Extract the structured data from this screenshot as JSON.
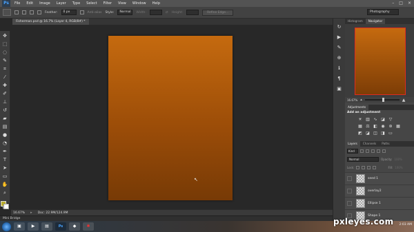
{
  "app": {
    "logo": "Ps"
  },
  "menu": [
    "File",
    "Edit",
    "Image",
    "Layer",
    "Type",
    "Select",
    "Filter",
    "View",
    "Window",
    "Help"
  ],
  "window_controls": {
    "minimize": "–",
    "maximize": "□",
    "close": "×"
  },
  "options_bar": {
    "feather_label": "Feather:",
    "feather_value": "0 px",
    "anti_alias_label": "Anti-alias",
    "style_label": "Style:",
    "style_value": "Normal",
    "width_label": "Width:",
    "height_label": "Height:",
    "refine_edge_label": "Refine Edge...",
    "workspace": "Photography"
  },
  "document_tab": "Fisherman.psd @ 16.7% (Layer 4, RGB/8#) *",
  "status_bar": {
    "zoom": "16.67%",
    "doc_size": "Doc: 22.9M/124.9M"
  },
  "mini_bridge": "Mini Bridge",
  "panels": {
    "nav_tabs": [
      "Histogram",
      "Navigator"
    ],
    "nav_zoom": "16.67%",
    "adjustments": {
      "tab": "Adjustments",
      "title": "Add an adjustment"
    },
    "layers_tabs": [
      "Layers",
      "Channels",
      "Paths"
    ],
    "kind": "Kind",
    "blend_mode": "Normal",
    "opacity_label": "Opacity:",
    "opacity_value": "100%",
    "lock_label": "Lock:",
    "fill_label": "Fill:",
    "fill_value": "100%",
    "layers": [
      "seed 1",
      "overlay2",
      "Ellipse 1",
      "Shape 1"
    ]
  },
  "taskbar": {
    "clock": "2:03 AM"
  },
  "watermark": "pxleyes.com",
  "colors": {
    "canvas_top": "#c56a0f",
    "canvas_bottom": "#773a06",
    "foreground_swatch": "#b9ac2c",
    "background_swatch": "#ffffff",
    "navigator_frame": "#e12b1f"
  }
}
